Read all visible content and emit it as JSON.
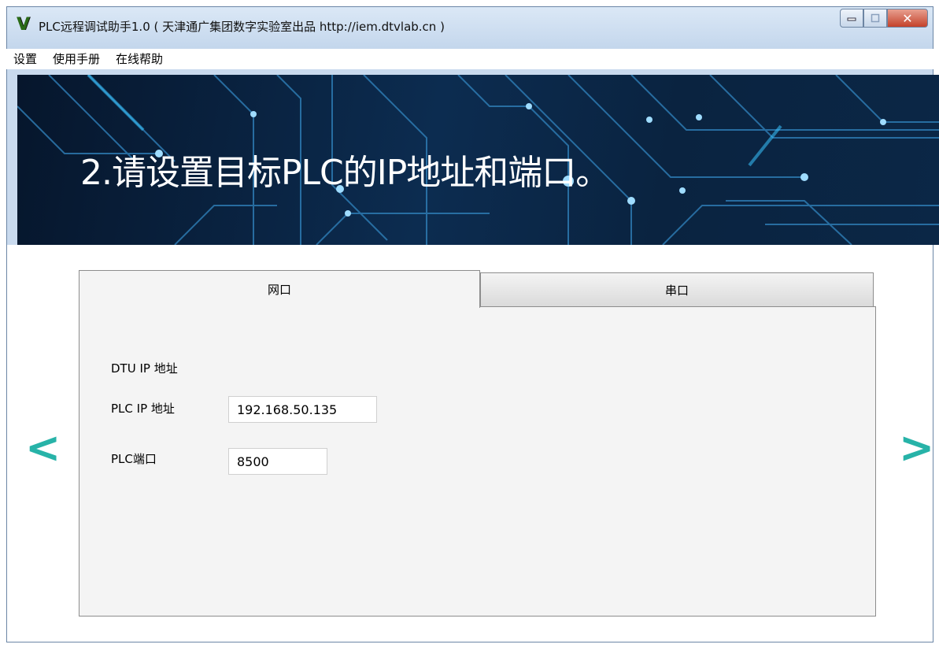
{
  "window": {
    "title": "PLC远程调试助手1.0 ( 天津通广集团数字实验室出品 http://iem.dtvlab.cn )",
    "icon": "V",
    "buttons": {
      "minimize": "minimize-icon",
      "maximize": "maximize-icon",
      "close": "✕"
    }
  },
  "menu": {
    "items": [
      "设置",
      "使用手册",
      "在线帮助"
    ]
  },
  "banner": {
    "title": "2.请设置目标PLC的IP地址和端口。"
  },
  "nav": {
    "prev": "<",
    "next": ">"
  },
  "tabs": [
    {
      "label": "网口",
      "active": true
    },
    {
      "label": "串口",
      "active": false
    }
  ],
  "form": {
    "dtu_ip_label": "DTU IP 地址",
    "plc_ip_label": "PLC IP 地址",
    "plc_ip_value": "192.168.50.135",
    "plc_port_label": "PLC端口",
    "plc_port_value": "8500"
  },
  "colors": {
    "accent_arrow": "#27b3a8",
    "highlight_ring": "#e01818",
    "banner_bg": "#0c2c50"
  }
}
